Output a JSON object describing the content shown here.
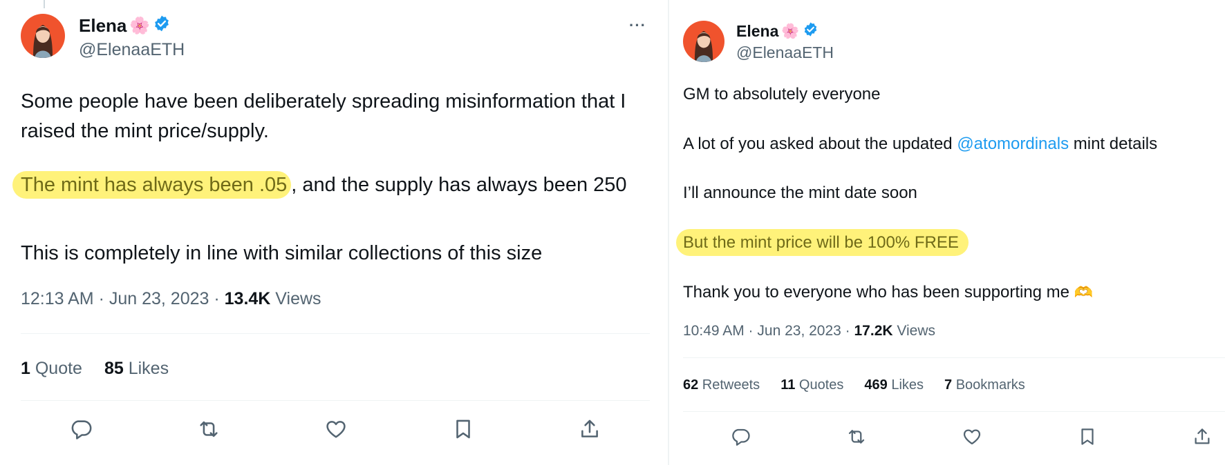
{
  "left": {
    "name": "Elena",
    "name_emoji": "🌸",
    "handle": "@ElenaaETH",
    "more_label": "···",
    "line1": "Some people have been deliberately spreading misinformation that I",
    "line2": "raised the mint price/supply.",
    "highlight": "The mint has always been .05",
    "line3_rest": ", and the supply has always been 250",
    "line4": "This is completely in line with similar collections of this size",
    "timestamp": "12:13 AM · Jun 23, 2023",
    "sep": " · ",
    "views_count": "13.4K",
    "views_label": " Views",
    "stats": [
      {
        "count": "1",
        "label": " Quote"
      },
      {
        "count": "85",
        "label": " Likes"
      }
    ]
  },
  "right": {
    "name": "Elena",
    "name_emoji": "🌸",
    "handle": "@ElenaaETH",
    "line1": "GM to absolutely everyone",
    "line2_pre": "A lot of you asked about the updated ",
    "line2_mention": "@atomordinals",
    "line2_post": " mint details",
    "line3": "I’ll announce the mint date soon",
    "highlight": "But the mint price will be 100% FREE",
    "line5": "Thank you to everyone who has been supporting me",
    "line5_emoji": "🫶",
    "timestamp": "10:49 AM · Jun 23, 2023",
    "sep": " · ",
    "views_count": "17.2K",
    "views_label": " Views",
    "stats": [
      {
        "count": "62",
        "label": " Retweets"
      },
      {
        "count": "11",
        "label": " Quotes"
      },
      {
        "count": "469",
        "label": " Likes"
      },
      {
        "count": "7",
        "label": " Bookmarks"
      }
    ]
  },
  "icons": {
    "reply": "reply-icon",
    "retweet": "retweet-icon",
    "like": "like-icon",
    "bookmark": "bookmark-icon",
    "share": "share-icon",
    "verified": "verified-badge-icon"
  },
  "colors": {
    "text": "#0f1419",
    "secondary": "#536471",
    "link": "#1d9bf0",
    "highlight": "#fff27a",
    "verified": "#1d9bf0",
    "avatar_bg": "#f0532d"
  }
}
